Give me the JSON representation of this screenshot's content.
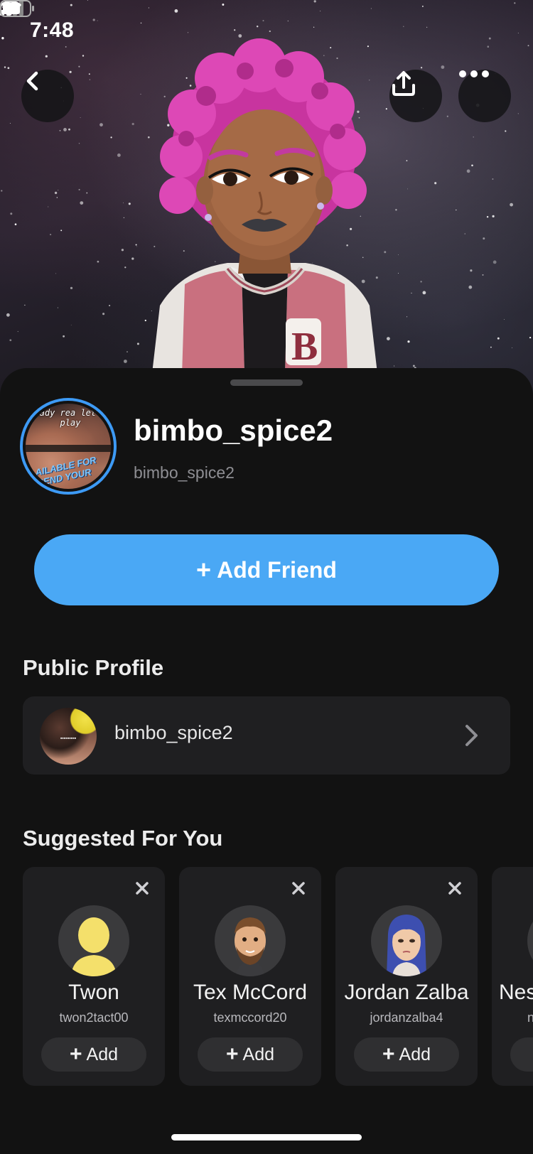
{
  "status_bar": {
    "time": "7:48"
  },
  "profile": {
    "display_name": "bimbo_spice2",
    "username": "bimbo_spice2",
    "avatar_text_top": "eady rea let's play",
    "avatar_text_bottom": "AILABLE FOR SEND YOUR"
  },
  "actions": {
    "add_friend_label": "Add Friend",
    "add_friend_plus": "+"
  },
  "public_profile": {
    "title": "Public Profile",
    "name": "bimbo_spice2"
  },
  "suggested": {
    "title": "Suggested For You",
    "add_label": "Add",
    "add_plus": "+",
    "items": [
      {
        "name": "Twon",
        "username": "twon2tact00"
      },
      {
        "name": "Tex McCord",
        "username": "texmccord20"
      },
      {
        "name": "Jordan Zalba",
        "username": "jordanzalba4"
      },
      {
        "name": "Nes",
        "username": "n"
      }
    ]
  },
  "icons": {
    "back": "chevron-left-icon",
    "share": "share-icon",
    "more": "more-horizontal-icon",
    "close": "close-icon",
    "chevron": "chevron-right-icon"
  },
  "colors": {
    "accent": "#4aa8f5",
    "ring": "#3d9af5",
    "background": "#121212",
    "card": "#1f1f21",
    "bitmoji_hair": "#d63fb0",
    "jacket": "#c9707f"
  }
}
